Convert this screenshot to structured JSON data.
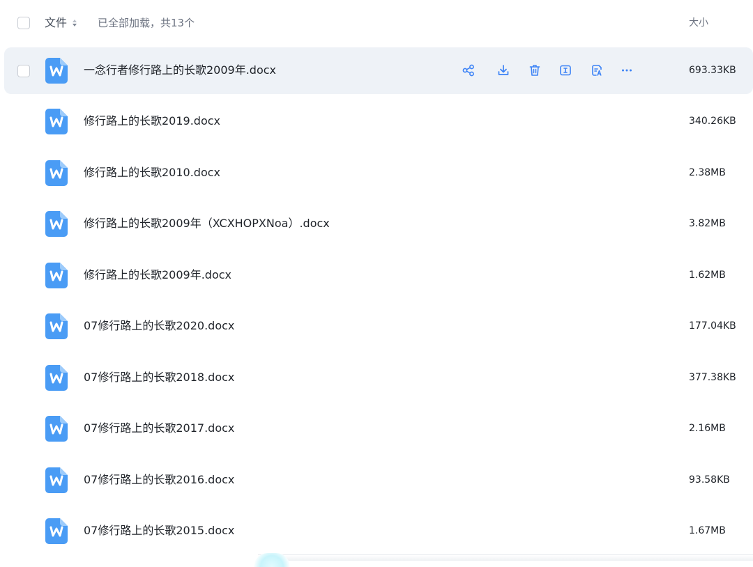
{
  "header": {
    "name_label": "文件",
    "status_text": "已全部加载，共13个",
    "size_label": "大小"
  },
  "files": [
    {
      "name": "一念行者修行路上的长歌2009年.docx",
      "size": "693.33KB",
      "icon": "word-doc-icon"
    },
    {
      "name": "修行路上的长歌2019.docx",
      "size": "340.26KB",
      "icon": "word-doc-icon"
    },
    {
      "name": "修行路上的长歌2010.docx",
      "size": "2.38MB",
      "icon": "word-doc-icon"
    },
    {
      "name": "修行路上的长歌2009年（XCXHOPXNoa）.docx",
      "size": "3.82MB",
      "icon": "word-doc-icon"
    },
    {
      "name": "修行路上的长歌2009年.docx",
      "size": "1.62MB",
      "icon": "word-doc-icon"
    },
    {
      "name": "07修行路上的长歌2020.docx",
      "size": "177.04KB",
      "icon": "word-doc-icon"
    },
    {
      "name": "07修行路上的长歌2018.docx",
      "size": "377.38KB",
      "icon": "word-doc-icon"
    },
    {
      "name": "07修行路上的长歌2017.docx",
      "size": "2.16MB",
      "icon": "word-doc-icon"
    },
    {
      "name": "07修行路上的长歌2016.docx",
      "size": "93.58KB",
      "icon": "word-doc-icon"
    },
    {
      "name": "07修行路上的长歌2015.docx",
      "size": "1.67MB",
      "icon": "word-doc-icon"
    }
  ],
  "row_actions": [
    "share-icon",
    "download-icon",
    "delete-icon",
    "rename-icon",
    "ai-assistant-icon",
    "more-icon"
  ],
  "colors": {
    "accent": "#3b82f6",
    "hover_row": "#eef2f7",
    "doc_icon": "#4a9cf5"
  }
}
